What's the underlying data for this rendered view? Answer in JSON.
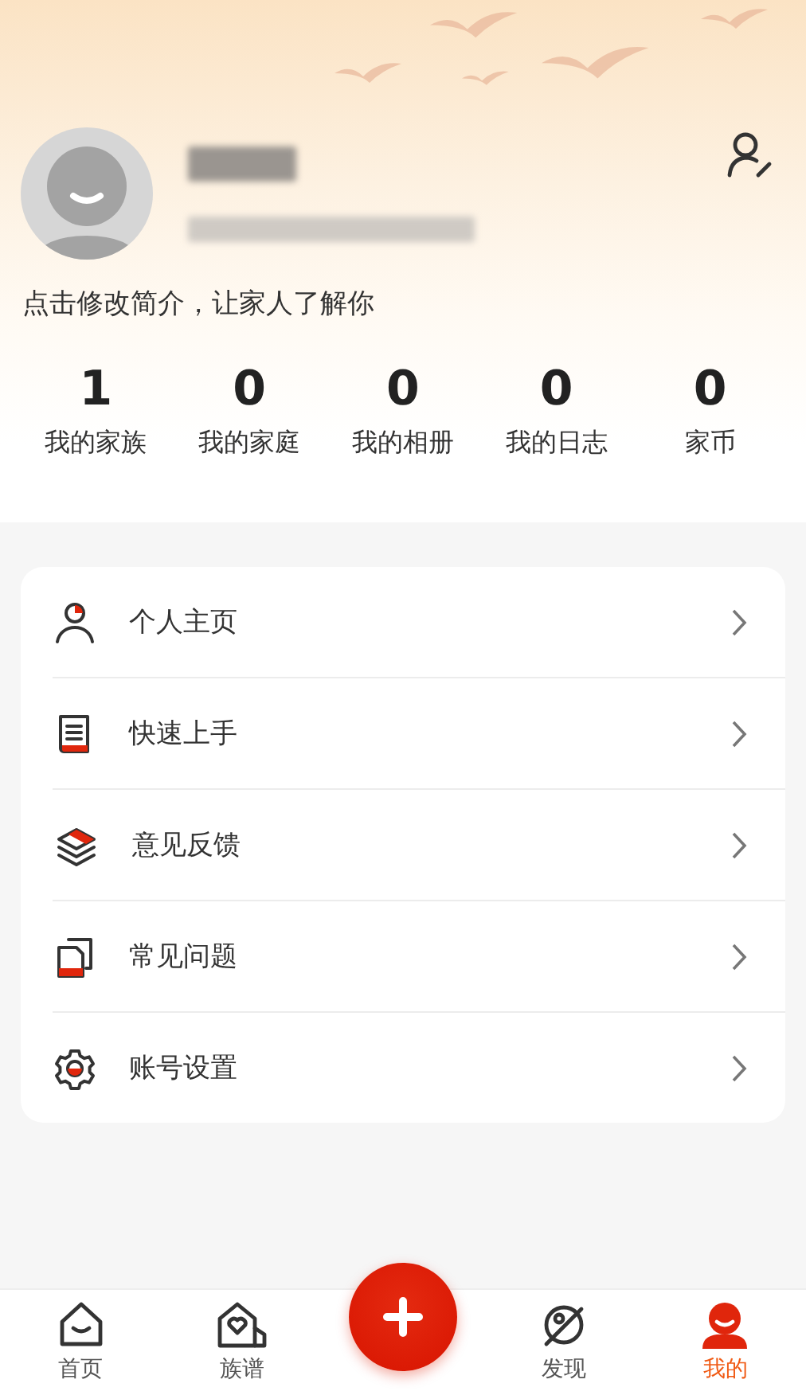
{
  "profile": {
    "bio": "点击修改简介，让家人了解你"
  },
  "stats": [
    {
      "value": "1",
      "label": "我的家族"
    },
    {
      "value": "0",
      "label": "我的家庭"
    },
    {
      "value": "0",
      "label": "我的相册"
    },
    {
      "value": "0",
      "label": "我的日志"
    },
    {
      "value": "0",
      "label": "家币"
    }
  ],
  "menu": [
    {
      "label": "个人主页"
    },
    {
      "label": "快速上手"
    },
    {
      "label": "意见反馈"
    },
    {
      "label": "常见问题"
    },
    {
      "label": "账号设置"
    }
  ],
  "tab_bar": [
    {
      "kind": "tab",
      "label": "首页",
      "selected": false
    },
    {
      "kind": "tab",
      "label": "族谱",
      "selected": false
    },
    {
      "kind": "add"
    },
    {
      "kind": "tab",
      "label": "发现",
      "selected": false
    },
    {
      "kind": "tab",
      "label": "我的",
      "selected": true
    }
  ]
}
